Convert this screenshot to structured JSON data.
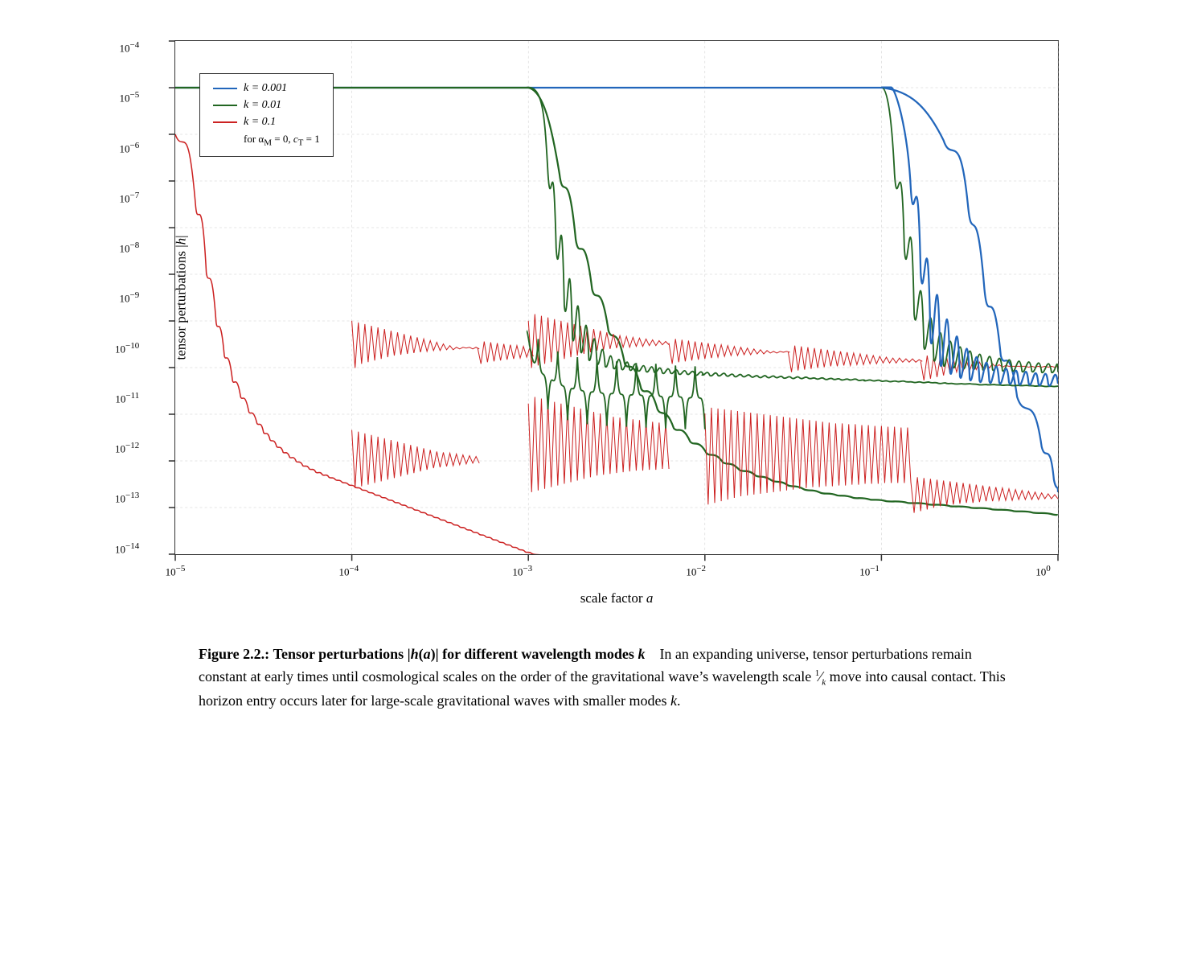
{
  "figure": {
    "label": "Figure 2.2.:",
    "title_bold_prefix": "Tensor perturbations ",
    "title_bold_math": "|h(a)|",
    "title_bold_suffix": " for different wavelength modes ",
    "title_bold_k": "k",
    "caption_body": "In an expanding universe, tensor perturbations remain constant at early times until cosmological scales on the order of the gravitational wave’s wave‐length scale ",
    "caption_frac": "1/k",
    "caption_body2": " move into causal contact. This horizon entry occurs later for large-scale gravitational waves with smaller modes ",
    "caption_k_end": "k",
    "caption_period": "."
  },
  "chart": {
    "y_label": "tensor perturbations |h|",
    "x_label": "scale factor a",
    "y_ticks": [
      "10⁻⁴",
      "10⁻⁵",
      "10⁻⁶",
      "10⁻⁷",
      "10⁻⁸",
      "10⁻⁹",
      "10⁻¹⁰",
      "10⁻¹¹",
      "10⁻¹²",
      "10⁻¹³",
      "10⁻¹⁴"
    ],
    "x_ticks": [
      "10⁻⁵",
      "10⁻⁴",
      "10⁻³",
      "10⁻²",
      "10⁻¹",
      "10⁰"
    ]
  },
  "legend": {
    "items": [
      {
        "label": "k = 0.001",
        "color": "#2266bb"
      },
      {
        "label": "k = 0.01",
        "color": "#226622"
      },
      {
        "label": "k = 0.1",
        "color": "#cc2222"
      }
    ],
    "note": "for αₘ = 0, cₜ = 1"
  }
}
